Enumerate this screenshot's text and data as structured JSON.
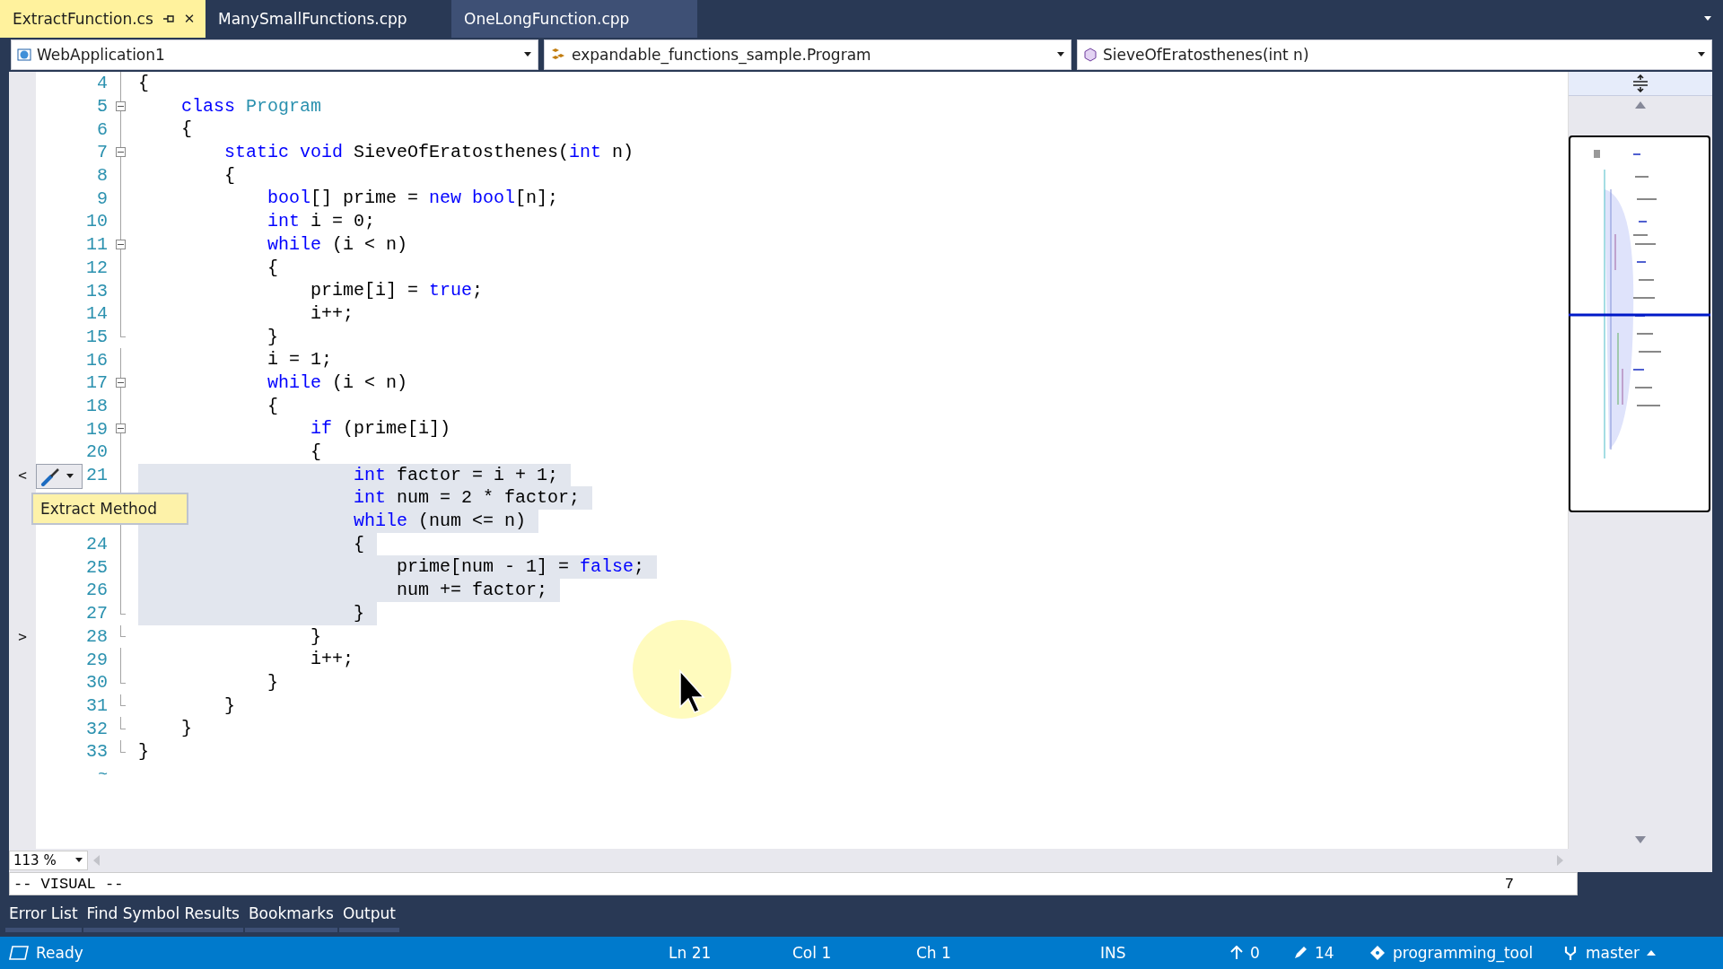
{
  "tabs": [
    {
      "label": "ExtractFunction.cs",
      "selected": true,
      "hovered": false,
      "pinned": true,
      "close": "✕"
    },
    {
      "label": "ManySmallFunctions.cpp",
      "selected": false,
      "hovered": false,
      "pinned": false
    },
    {
      "label": "OneLongFunction.cpp",
      "selected": false,
      "hovered": true,
      "pinned": false
    }
  ],
  "navigation": [
    {
      "kind": "project",
      "label": "WebApplication1"
    },
    {
      "kind": "class",
      "label": "expandable_functions_sample.Program"
    },
    {
      "kind": "method",
      "label": "SieveOfEratosthenes(int n)"
    }
  ],
  "editor": {
    "lines": [
      {
        "number": "4",
        "collapsible": false,
        "block_end": false,
        "selected": false,
        "tokens": [
          {
            "kind": "text",
            "text": "{"
          }
        ]
      },
      {
        "number": "5",
        "collapsible": true,
        "block_end": false,
        "selected": false,
        "tokens": [
          {
            "kind": "keyword",
            "text": "    class"
          },
          {
            "kind": "type",
            "text": " Program"
          }
        ]
      },
      {
        "number": "6",
        "collapsible": false,
        "block_end": false,
        "selected": false,
        "tokens": [
          {
            "kind": "text",
            "text": "    {"
          }
        ]
      },
      {
        "number": "7",
        "collapsible": true,
        "block_end": false,
        "selected": false,
        "tokens": [
          {
            "kind": "keyword",
            "text": "        static"
          },
          {
            "kind": "keyword",
            "text": " void"
          },
          {
            "kind": "text",
            "text": " SieveOfEratosthenes("
          },
          {
            "kind": "keyword",
            "text": "int"
          },
          {
            "kind": "text",
            "text": " n)"
          }
        ]
      },
      {
        "number": "8",
        "collapsible": false,
        "block_end": false,
        "selected": false,
        "tokens": [
          {
            "kind": "text",
            "text": "        {"
          }
        ]
      },
      {
        "number": "9",
        "collapsible": false,
        "block_end": false,
        "selected": false,
        "tokens": [
          {
            "kind": "keyword",
            "text": "            bool"
          },
          {
            "kind": "text",
            "text": "[] prime = "
          },
          {
            "kind": "keyword",
            "text": "new"
          },
          {
            "kind": "keyword",
            "text": " bool"
          },
          {
            "kind": "text",
            "text": "[n];"
          }
        ]
      },
      {
        "number": "10",
        "collapsible": false,
        "block_end": false,
        "selected": false,
        "tokens": [
          {
            "kind": "keyword",
            "text": "            int"
          },
          {
            "kind": "text",
            "text": " i = 0;"
          }
        ]
      },
      {
        "number": "11",
        "collapsible": true,
        "block_end": false,
        "selected": false,
        "tokens": [
          {
            "kind": "keyword",
            "text": "            while"
          },
          {
            "kind": "text",
            "text": " (i < n)"
          }
        ]
      },
      {
        "number": "12",
        "collapsible": false,
        "block_end": false,
        "selected": false,
        "tokens": [
          {
            "kind": "text",
            "text": "            {"
          }
        ]
      },
      {
        "number": "13",
        "collapsible": false,
        "block_end": false,
        "selected": false,
        "tokens": [
          {
            "kind": "text",
            "text": "                prime[i] = "
          },
          {
            "kind": "keyword",
            "text": "true"
          },
          {
            "kind": "text",
            "text": ";"
          }
        ]
      },
      {
        "number": "14",
        "collapsible": false,
        "block_end": false,
        "selected": false,
        "tokens": [
          {
            "kind": "text",
            "text": "                i++;"
          }
        ]
      },
      {
        "number": "15",
        "collapsible": false,
        "block_end": true,
        "selected": false,
        "tokens": [
          {
            "kind": "text",
            "text": "            }"
          }
        ]
      },
      {
        "number": "16",
        "collapsible": false,
        "block_end": false,
        "selected": false,
        "tokens": [
          {
            "kind": "text",
            "text": "            i = 1;"
          }
        ]
      },
      {
        "number": "17",
        "collapsible": true,
        "block_end": false,
        "selected": false,
        "tokens": [
          {
            "kind": "keyword",
            "text": "            while"
          },
          {
            "kind": "text",
            "text": " (i < n)"
          }
        ]
      },
      {
        "number": "18",
        "collapsible": false,
        "block_end": false,
        "selected": false,
        "tokens": [
          {
            "kind": "text",
            "text": "            {"
          }
        ]
      },
      {
        "number": "19",
        "collapsible": true,
        "block_end": false,
        "selected": false,
        "tokens": [
          {
            "kind": "keyword",
            "text": "                if"
          },
          {
            "kind": "text",
            "text": " (prime[i])"
          }
        ]
      },
      {
        "number": "20",
        "collapsible": false,
        "block_end": false,
        "selected": false,
        "tokens": [
          {
            "kind": "text",
            "text": "                {"
          }
        ]
      },
      {
        "number": "21",
        "collapsible": false,
        "block_end": false,
        "selected": true,
        "marker": "<",
        "quick_action": "Extract Method",
        "tokens": [
          {
            "kind": "keyword",
            "text": "                    int"
          },
          {
            "kind": "text",
            "text": " factor = i + 1;"
          }
        ]
      },
      {
        "collapsible": false,
        "block_end": false,
        "selected": true,
        "tokens": [
          {
            "kind": "keyword",
            "text": "                    int"
          },
          {
            "kind": "text",
            "text": " num = 2 * factor;"
          }
        ]
      },
      {
        "collapsible": false,
        "block_end": false,
        "selected": true,
        "tokens": [
          {
            "kind": "keyword",
            "text": "                    while"
          },
          {
            "kind": "text",
            "text": " (num <= n)"
          }
        ]
      },
      {
        "number": "24",
        "collapsible": false,
        "block_end": false,
        "selected": true,
        "tokens": [
          {
            "kind": "text",
            "text": "                    {"
          }
        ]
      },
      {
        "number": "25",
        "collapsible": false,
        "block_end": false,
        "selected": true,
        "tokens": [
          {
            "kind": "text",
            "text": "                        prime[num - 1] = "
          },
          {
            "kind": "keyword",
            "text": "false"
          },
          {
            "kind": "text",
            "text": ";"
          }
        ]
      },
      {
        "number": "26",
        "collapsible": false,
        "block_end": false,
        "selected": true,
        "tokens": [
          {
            "kind": "text",
            "text": "                        num += factor;"
          }
        ]
      },
      {
        "number": "27",
        "collapsible": false,
        "block_end": true,
        "selected": true,
        "tokens": [
          {
            "kind": "text",
            "text": "                    }"
          }
        ]
      },
      {
        "number": "28",
        "collapsible": false,
        "block_end": true,
        "selected": false,
        "marker": ">",
        "tokens": [
          {
            "kind": "text",
            "text": "                }"
          }
        ]
      },
      {
        "number": "29",
        "collapsible": false,
        "block_end": false,
        "selected": false,
        "tokens": [
          {
            "kind": "text",
            "text": "                i++;"
          }
        ]
      },
      {
        "number": "30",
        "collapsible": false,
        "block_end": true,
        "selected": false,
        "tokens": [
          {
            "kind": "text",
            "text": "            }"
          }
        ]
      },
      {
        "number": "31",
        "collapsible": false,
        "block_end": true,
        "selected": false,
        "tokens": [
          {
            "kind": "text",
            "text": "        }"
          }
        ]
      },
      {
        "number": "32",
        "collapsible": false,
        "block_end": true,
        "selected": false,
        "tokens": [
          {
            "kind": "text",
            "text": "    }"
          }
        ]
      },
      {
        "number": "33",
        "collapsible": false,
        "block_end": true,
        "selected": false,
        "tokens": [
          {
            "kind": "text",
            "text": "}"
          }
        ]
      }
    ],
    "end_marker": "~"
  },
  "zoom": "113 %",
  "mode_line": {
    "mode": "-- VISUAL --",
    "count": "7"
  },
  "tool_tabs": [
    "Error List",
    "Find Symbol Results",
    "Bookmarks",
    "Output"
  ],
  "status_bar": {
    "state": "Ready",
    "line": "Ln 21",
    "column": "Col 1",
    "char": "Ch 1",
    "insert": "INS",
    "unpushed": "0",
    "changes": "14",
    "repository": "programming_tool",
    "branch": "master"
  }
}
